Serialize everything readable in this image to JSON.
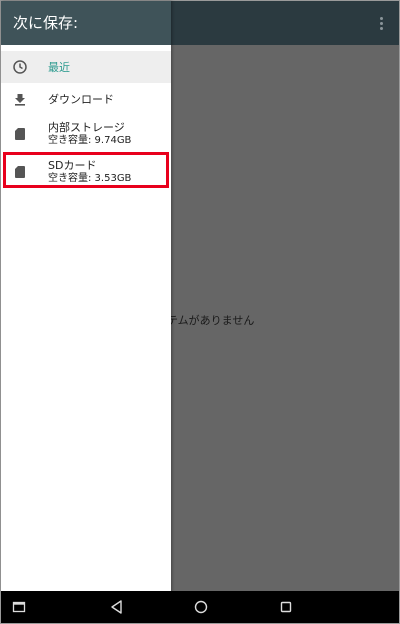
{
  "header": {
    "title": "次に保存:"
  },
  "background": {
    "empty_message": "テムがありません"
  },
  "drawer": {
    "items": [
      {
        "label": "最近",
        "icon": "clock-icon",
        "selected": true
      },
      {
        "label": "ダウンロード",
        "icon": "download-icon"
      },
      {
        "label": "内部ストレージ",
        "sub": "空き容量: 9.74GB",
        "icon": "storage-icon"
      },
      {
        "label": "SDカード",
        "sub": "空き容量: 3.53GB",
        "icon": "sd-card-icon",
        "highlighted": true
      }
    ]
  },
  "navbar": {
    "buttons": [
      "recents-app-icon",
      "back-icon",
      "home-icon",
      "overview-icon"
    ]
  },
  "colors": {
    "accent": "#2a9a8e",
    "header": "#3f5359",
    "highlight": "#e8001c",
    "scrim": "#666666"
  }
}
